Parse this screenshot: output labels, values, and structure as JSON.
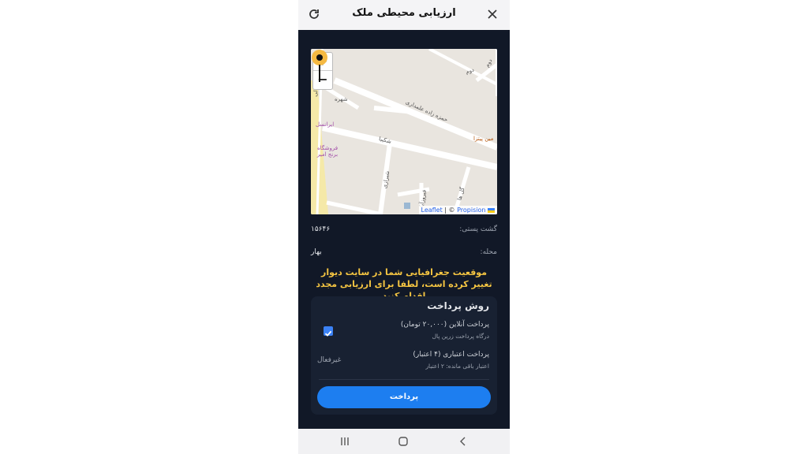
{
  "header": {
    "title": "ارزیابی محیطی ملک",
    "refresh_icon": "refresh-icon",
    "close_icon": "close-icon"
  },
  "map": {
    "zoom_in": "+",
    "zoom_out": "−",
    "attribution_leaflet": "Leaflet",
    "attribution_sep": "| ©",
    "attribution_provider": "Propision",
    "street_labels": {
      "s1": "حمزه زاده علمداری",
      "s2": "شکیبا",
      "s3": "شهره",
      "s4": "شیرازی",
      "s5": "فیروزآبادی",
      "s6": "گل ها",
      "s7": "دوم",
      "s8": "دوم",
      "s9": "معالی"
    },
    "poi_labels": {
      "p1": "ایرانسل",
      "p2": "فروشگاه برنج امیر",
      "p3": "مین پیتزا"
    }
  },
  "details": {
    "postal_label": "گشت پستی:",
    "postal_value": "۱۵۶۴۶",
    "district_label": "محله:",
    "district_value": "بهار"
  },
  "warning": "موقعیت جغرافیایی شما در سایت دیوار تغییر کرده است، لطفا برای ارزیابی مجدد اقدام کنید",
  "payment": {
    "title": "روش پرداخت",
    "online_label": "پرداخت آنلاین (۲۰,۰۰۰ تومان)",
    "online_sub": "درگاه پرداخت زرین پال",
    "credit_label": "پرداخت اعتباری (۴ اعتبار)",
    "credit_sub": "اعتبار باقی مانده: ۲ اعتبار",
    "inactive_label": "غیرفعال",
    "button_label": "پرداخت",
    "online_checked": true
  },
  "colors": {
    "background": "#111827",
    "accent": "#1d7ef0",
    "warning": "#f5c542",
    "pin": "#f5b942"
  }
}
